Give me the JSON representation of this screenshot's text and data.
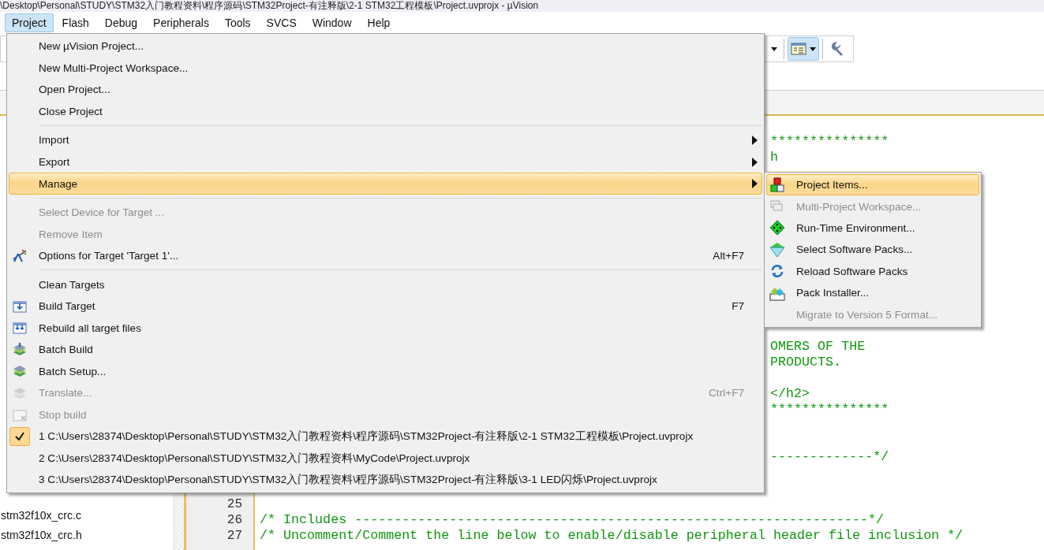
{
  "window": {
    "title": "\\Desktop\\Personal\\STUDY\\STM32入门教程资料\\程序源码\\STM32Project-有注释版\\2-1 STM32工程模板\\Project.uvprojx - µVision"
  },
  "menubar": [
    {
      "label": "Project",
      "selected": true
    },
    {
      "label": "Flash",
      "selected": false
    },
    {
      "label": "Debug",
      "selected": false
    },
    {
      "label": "Peripherals",
      "selected": false
    },
    {
      "label": "Tools",
      "selected": false
    },
    {
      "label": "SVCS",
      "selected": false
    },
    {
      "label": "Window",
      "selected": false
    },
    {
      "label": "Help",
      "selected": false
    }
  ],
  "toolbar": [
    {
      "kind": "caret",
      "selected": false
    },
    {
      "kind": "window",
      "selected": true
    },
    {
      "kind": "wrench",
      "selected": false
    }
  ],
  "sidebar": {
    "files": [
      "stm32f10x_crc.c",
      "stm32f10x_crc.h"
    ]
  },
  "editor": {
    "lines": [
      {
        "kind": "tail",
        "text": "***************"
      },
      {
        "kind": "tail",
        "text": "h"
      },
      {
        "kind": "blank"
      },
      {
        "kind": "blank"
      },
      {
        "kind": "blank"
      },
      {
        "kind": "blank"
      },
      {
        "kind": "blank"
      },
      {
        "kind": "blank"
      },
      {
        "kind": "blank"
      },
      {
        "kind": "blank"
      },
      {
        "kind": "blank"
      },
      {
        "kind": "blank"
      },
      {
        "kind": "blank"
      },
      {
        "kind": "tail",
        "text": "OMERS OF THE"
      },
      {
        "kind": "tail",
        "text": "PRODUCTS."
      },
      {
        "kind": "blank"
      },
      {
        "kind": "tail",
        "text": "</h2>"
      },
      {
        "kind": "tail",
        "text": "***************"
      },
      {
        "kind": "blank"
      },
      {
        "kind": "blank"
      },
      {
        "kind": "tail",
        "text": "-------------*/"
      },
      {
        "kind": "blank"
      },
      {
        "kind": "blank"
      },
      {
        "kind": "blank",
        "number": "25"
      },
      {
        "kind": "full",
        "number": "26",
        "text": "/* Includes -----------------------------------------------------------------*/"
      },
      {
        "kind": "full",
        "number": "27",
        "text": "/* Uncomment/Comment the line below to enable/disable peripheral header file inclusion */"
      }
    ]
  },
  "main_menu": {
    "items": [
      {
        "kind": "item",
        "label": "New µVision Project...",
        "disabled": false,
        "selected": false,
        "checked": false,
        "submenu": false
      },
      {
        "kind": "item",
        "label": "New Multi-Project Workspace...",
        "disabled": false,
        "selected": false,
        "checked": false,
        "submenu": false
      },
      {
        "kind": "item",
        "label": "Open Project...",
        "disabled": false,
        "selected": false,
        "checked": false,
        "submenu": false
      },
      {
        "kind": "item",
        "label": "Close Project",
        "disabled": false,
        "selected": false,
        "checked": false,
        "submenu": false
      },
      {
        "kind": "separator"
      },
      {
        "kind": "item",
        "label": "Import",
        "disabled": false,
        "selected": false,
        "checked": false,
        "submenu": true
      },
      {
        "kind": "item",
        "label": "Export",
        "disabled": false,
        "selected": false,
        "checked": false,
        "submenu": true
      },
      {
        "kind": "item",
        "label": "Manage",
        "disabled": false,
        "selected": true,
        "checked": false,
        "submenu": true
      },
      {
        "kind": "separator"
      },
      {
        "kind": "item",
        "label": "Select Device for Target ...",
        "disabled": true,
        "selected": false,
        "checked": false,
        "submenu": false
      },
      {
        "kind": "item",
        "label": "Remove Item",
        "disabled": true,
        "selected": false,
        "checked": false,
        "submenu": false
      },
      {
        "kind": "item",
        "label": "Options for Target 'Target 1'...",
        "shortcut": "Alt+F7",
        "disabled": false,
        "selected": false,
        "checked": false,
        "submenu": false
      },
      {
        "kind": "separator"
      },
      {
        "kind": "item",
        "label": "Clean Targets",
        "disabled": false,
        "selected": false,
        "checked": false,
        "submenu": false
      },
      {
        "kind": "item",
        "label": "Build Target",
        "shortcut": "F7",
        "disabled": false,
        "selected": false,
        "checked": false,
        "submenu": false
      },
      {
        "kind": "item",
        "label": "Rebuild all target files",
        "disabled": false,
        "selected": false,
        "checked": false,
        "submenu": false
      },
      {
        "kind": "item",
        "label": "Batch Build",
        "disabled": false,
        "selected": false,
        "checked": false,
        "submenu": false
      },
      {
        "kind": "item",
        "label": "Batch Setup...",
        "disabled": false,
        "selected": false,
        "checked": false,
        "submenu": false
      },
      {
        "kind": "item",
        "label": "Translate...",
        "shortcut": "Ctrl+F7",
        "disabled": true,
        "selected": false,
        "checked": false,
        "submenu": false
      },
      {
        "kind": "item",
        "label": "Stop build",
        "disabled": true,
        "selected": false,
        "checked": false,
        "submenu": false
      },
      {
        "kind": "item",
        "label": "1 C:\\Users\\28374\\Desktop\\Personal\\STUDY\\STM32入门教程资料\\程序源码\\STM32Project-有注释版\\2-1 STM32工程模板\\Project.uvprojx",
        "disabled": false,
        "selected": false,
        "checked": true,
        "submenu": false
      },
      {
        "kind": "item",
        "label": "2 C:\\Users\\28374\\Desktop\\Personal\\STUDY\\STM32入门教程资料\\MyCode\\Project.uvprojx",
        "disabled": false,
        "selected": false,
        "checked": false,
        "submenu": false
      },
      {
        "kind": "item",
        "label": "3 C:\\Users\\28374\\Desktop\\Personal\\STUDY\\STM32入门教程资料\\程序源码\\STM32Project-有注释版\\3-1 LED闪烁\\Project.uvprojx",
        "disabled": false,
        "selected": false,
        "checked": false,
        "submenu": false
      }
    ]
  },
  "manage_submenu": {
    "items": [
      {
        "label": "Project Items...",
        "disabled": false,
        "selected": true
      },
      {
        "label": "Multi-Project Workspace...",
        "disabled": true,
        "selected": false
      },
      {
        "label": "Run-Time Environment...",
        "disabled": false,
        "selected": false
      },
      {
        "label": "Select Software Packs...",
        "disabled": false,
        "selected": false
      },
      {
        "label": "Reload Software Packs",
        "disabled": false,
        "selected": false
      },
      {
        "label": "Pack Installer...",
        "disabled": false,
        "selected": false
      },
      {
        "label": "Migrate to Version 5 Format...",
        "disabled": true,
        "selected": false
      }
    ]
  }
}
